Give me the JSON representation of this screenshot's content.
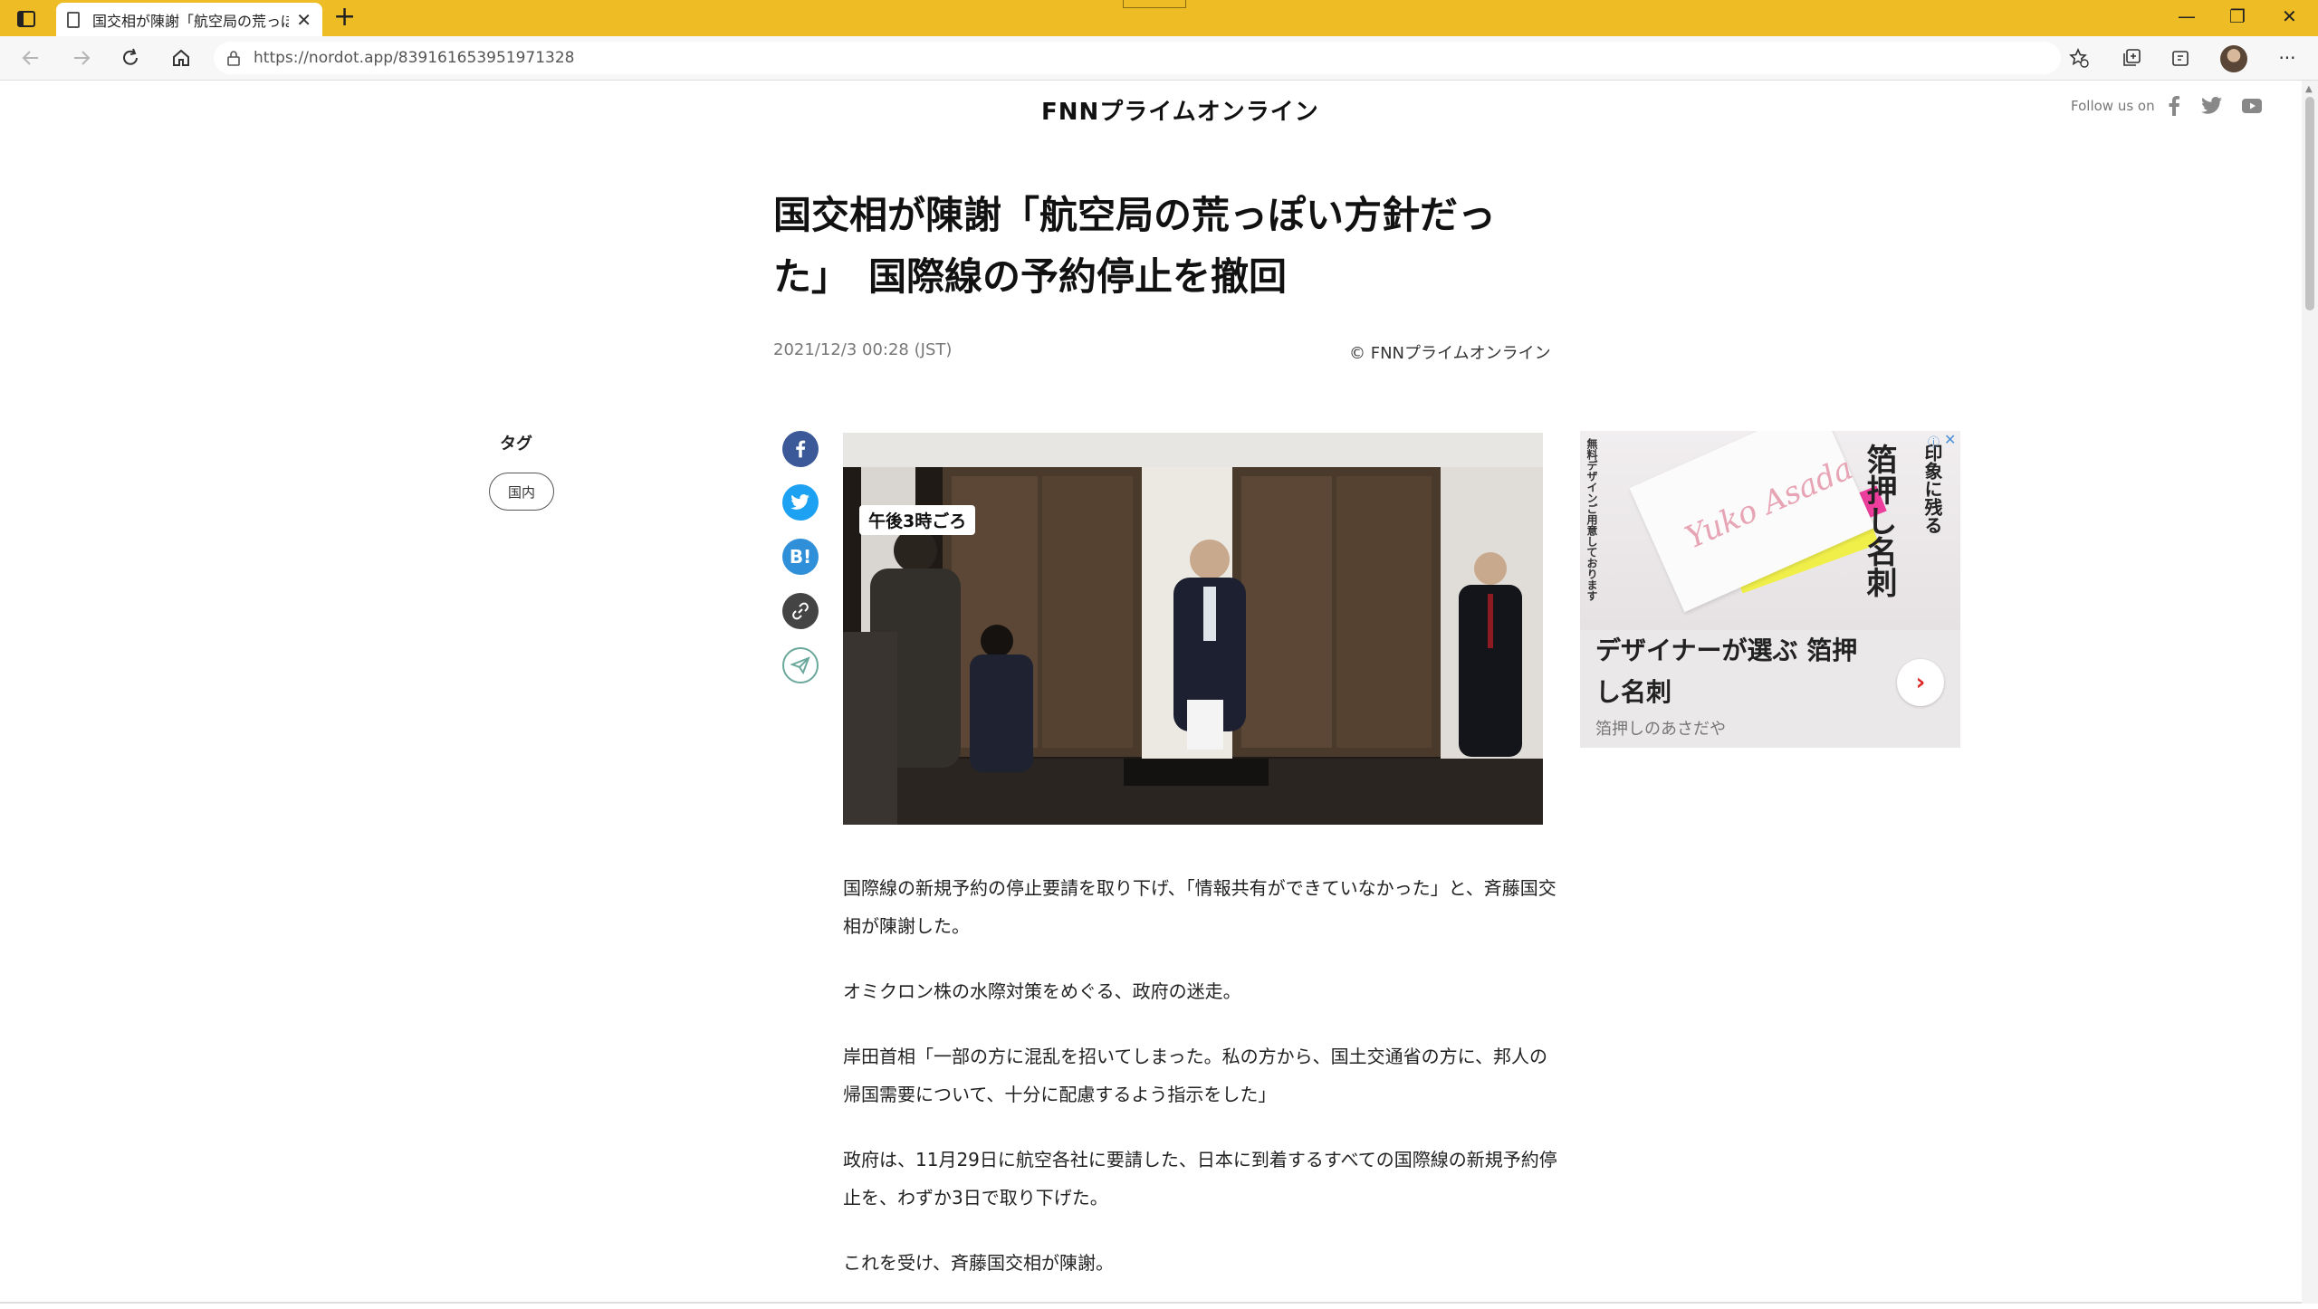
{
  "browser": {
    "tab_title": "国交相が陳謝「航空局の荒っぽい方",
    "tab_close": "✕",
    "new_tab": "+",
    "url": "https://nordot.app/839161653951971328",
    "window_controls": {
      "minimize": "—",
      "restore": "❐",
      "close": "✕"
    },
    "more": "···",
    "colors": {
      "titlebar": "#eebc24"
    }
  },
  "site": {
    "logo": "FNNプライムオンライン",
    "follow_label": "Follow us on",
    "social_icons": [
      "facebook-icon",
      "twitter-icon",
      "youtube-icon"
    ]
  },
  "article": {
    "title": "国交相が陳謝「航空局の荒っぽい方針だった」　国際線の予約停止を撤回",
    "date": "2021/12/3 00:28 (JST)",
    "credit": "© FNNプライムオンライン",
    "photo_caption": "午後3時ごろ",
    "paragraphs": [
      "国際線の新規予約の停止要請を取り下げ、「情報共有ができていなかった」と、斉藤国交相が陳謝した。",
      "オミクロン株の水際対策をめぐる、政府の迷走。",
      "岸田首相「一部の方に混乱を招いてしまった。私の方から、国土交通省の方に、邦人の帰国需要について、十分に配慮するよう指示をした」",
      "政府は、11月29日に航空各社に要請した、日本に到着するすべての国際線の新規予約停止を、わずか3日で取り下げた。",
      "これを受け、斉藤国交相が陳謝。"
    ]
  },
  "tags": {
    "heading": "タグ",
    "items": [
      "国内"
    ]
  },
  "share": {
    "hatena_label": "B!",
    "colors": {
      "facebook": "#3b5998",
      "twitter": "#1da1f2",
      "hatena": "#2f8fd8",
      "link": "#444444",
      "line": "#6aa89c"
    }
  },
  "ad": {
    "info": "ⓘ",
    "close": "✕",
    "vertical_small": "無料デザインご用意しております",
    "vertical_headline": "箔押し名刺",
    "vertical_sub": "印象に残る",
    "script_text": "Yuko Asada",
    "headline": "デザイナーが選ぶ 箔押し名刺",
    "sponsor": "箔押しのあさだや",
    "arrow": "›"
  }
}
